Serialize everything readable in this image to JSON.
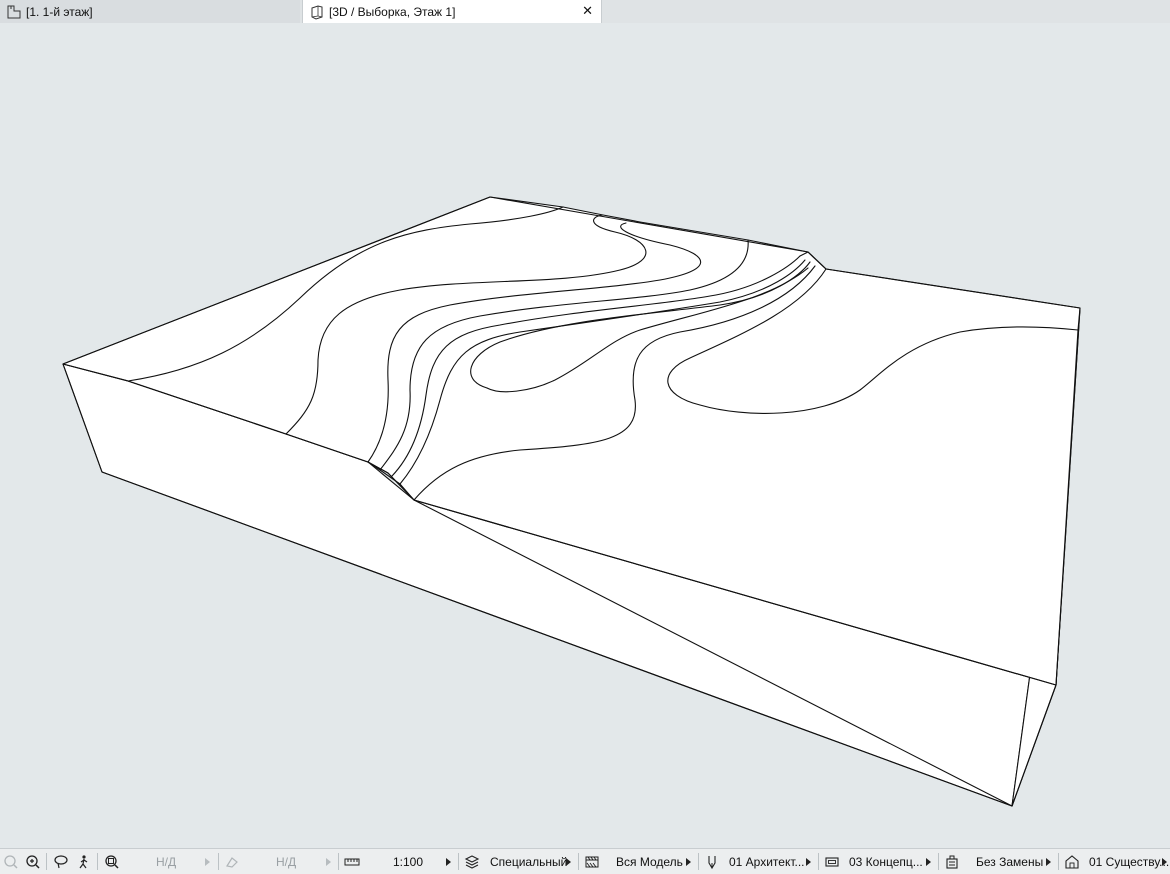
{
  "tabs": [
    {
      "label": "[1. 1-й этаж]",
      "icon": "floor-plan-icon",
      "active": false
    },
    {
      "label": "[3D / Выборка, Этаж 1]",
      "icon": "3d-window-icon",
      "active": true,
      "close": "✕"
    }
  ],
  "statusbar": {
    "na_1": "Н/Д",
    "na_2": "Н/Д",
    "scale": "1:100",
    "layer_combination": "Специальный",
    "model_view": "Вся Модель",
    "pen_set": "01 Архитект...",
    "model_view_options": "03 Концепц...",
    "graphic_override": "Без Замены",
    "renovation_filter": "01 Существу..."
  },
  "icons": {
    "undo_zoom": "undo-zoom-icon",
    "zoom": "zoom-in-icon",
    "lasso": "lasso-icon",
    "walk": "walk-icon",
    "fit": "fit-in-window-icon",
    "orbit": "orbit-icon",
    "measure": "ruler-icon",
    "layers": "layers-icon",
    "model_view": "model-view-icon",
    "pen": "pen-icon",
    "mvo": "model-view-options-icon",
    "override": "graphic-override-icon",
    "renovation": "renovation-icon"
  },
  "colors": {
    "viewport_bg": "#e3e8ea",
    "tab_active_bg": "#ffffff",
    "model_fill": "#ffffff",
    "model_stroke": "#111111"
  }
}
